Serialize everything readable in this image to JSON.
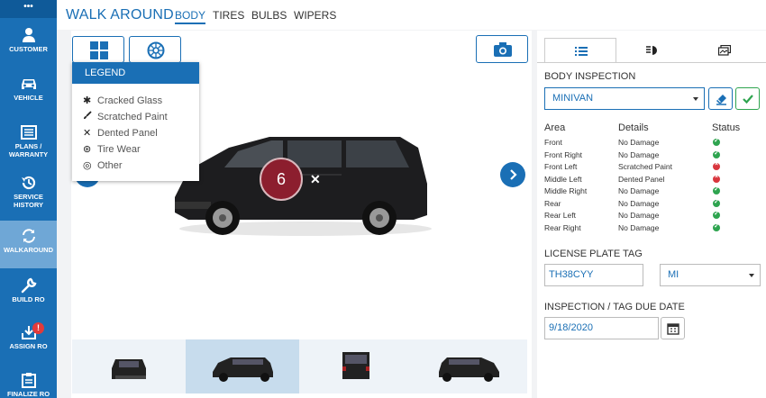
{
  "sidebar": {
    "top_label": "•••",
    "items": [
      {
        "label": "CUSTOMER",
        "icon": "person-icon"
      },
      {
        "label": "VEHICLE",
        "icon": "car-icon"
      },
      {
        "label1": "PLANS /",
        "label2": "WARRANTY",
        "icon": "list-icon"
      },
      {
        "label1": "SERVICE",
        "label2": "HISTORY",
        "icon": "history-icon"
      },
      {
        "label": "WALKAROUND",
        "icon": "refresh-icon"
      },
      {
        "label": "BUILD RO",
        "icon": "wrench-icon"
      },
      {
        "label": "ASSIGN RO",
        "icon": "download-icon",
        "badge": "!"
      },
      {
        "label": "FINALIZE RO",
        "icon": "clipboard-icon"
      }
    ]
  },
  "header": {
    "title": "WALK AROUND",
    "tabs": [
      "BODY",
      "TIRES",
      "BULBS",
      "WIPERS"
    ],
    "active_tab": "BODY"
  },
  "legend": {
    "title": "LEGEND",
    "items": [
      {
        "glyph": "✱",
        "label": "Cracked Glass"
      },
      {
        "glyph": "🖌",
        "label": "Scratched Paint"
      },
      {
        "glyph": "✕",
        "label": "Dented Panel"
      },
      {
        "glyph": "⊛",
        "label": "Tire Wear"
      },
      {
        "glyph": "◎",
        "label": "Other"
      }
    ]
  },
  "vehicle_view": {
    "marker_number": "6",
    "marker_glyph": "✕"
  },
  "inspection": {
    "section_title": "BODY INSPECTION",
    "vehicle_type": "MINIVAN",
    "columns": [
      "Area",
      "Details",
      "Status"
    ],
    "rows": [
      {
        "area": "Front",
        "details": "No Damage",
        "status": "ok"
      },
      {
        "area": "Front Right",
        "details": "No Damage",
        "status": "ok"
      },
      {
        "area": "Front Left",
        "details": "Scratched Paint",
        "status": "bad"
      },
      {
        "area": "Middle Left",
        "details": "Dented Panel",
        "status": "bad"
      },
      {
        "area": "Middle Right",
        "details": "No Damage",
        "status": "ok"
      },
      {
        "area": "Rear",
        "details": "No Damage",
        "status": "ok"
      },
      {
        "area": "Rear Left",
        "details": "No Damage",
        "status": "ok"
      },
      {
        "area": "Rear Right",
        "details": "No Damage",
        "status": "ok"
      }
    ]
  },
  "license": {
    "label": "LICENSE PLATE TAG",
    "plate": "TH38CYY",
    "state": "MI"
  },
  "due_date": {
    "label": "INSPECTION / TAG DUE DATE",
    "value": "9/18/2020"
  },
  "colors": {
    "primary": "#1a6fb5",
    "ok": "#2ea44f",
    "error": "#d9363e",
    "marker": "#8c1e2e"
  }
}
